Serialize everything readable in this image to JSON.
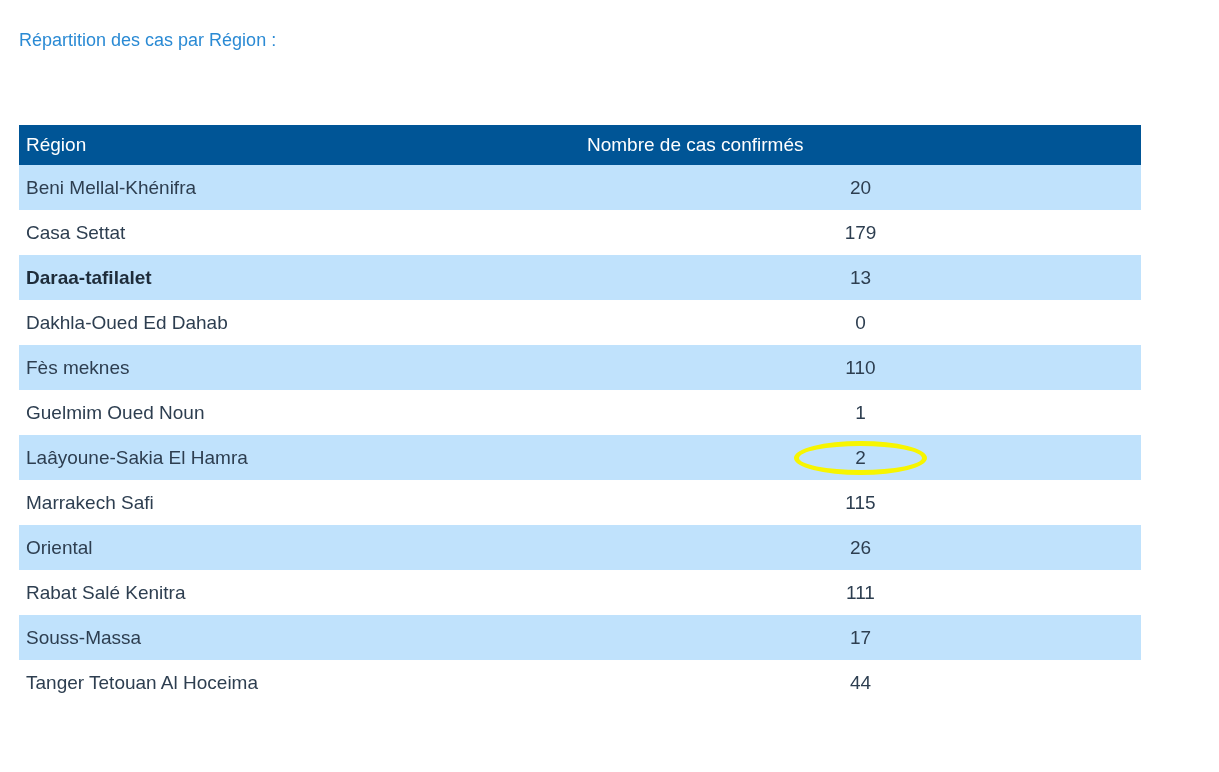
{
  "title": "Répartition des cas par Région :",
  "table": {
    "columns": [
      "Région",
      "Nombre de cas confirmés"
    ],
    "rows": [
      {
        "region": "Beni Mellal-Khénifra",
        "cases": "20",
        "bold": false,
        "circled": false
      },
      {
        "region": "Casa Settat",
        "cases": "179",
        "bold": false,
        "circled": false
      },
      {
        "region": "Daraa-tafilalet",
        "cases": "13",
        "bold": true,
        "circled": false
      },
      {
        "region": "Dakhla-Oued Ed Dahab",
        "cases": "0",
        "bold": false,
        "circled": false
      },
      {
        "region": "Fès meknes",
        "cases": "110",
        "bold": false,
        "circled": false
      },
      {
        "region": "Guelmim Oued Noun",
        "cases": "1",
        "bold": false,
        "circled": false
      },
      {
        "region": "Laâyoune-Sakia El Hamra",
        "cases": "2",
        "bold": false,
        "circled": true
      },
      {
        "region": "Marrakech Safi",
        "cases": "115",
        "bold": false,
        "circled": false
      },
      {
        "region": "Oriental",
        "cases": "26",
        "bold": false,
        "circled": false
      },
      {
        "region": "Rabat Salé Kenitra",
        "cases": "111",
        "bold": false,
        "circled": false
      },
      {
        "region": "Souss-Massa",
        "cases": "17",
        "bold": false,
        "circled": false
      },
      {
        "region": "Tanger Tetouan Al Hoceima",
        "cases": "44",
        "bold": false,
        "circled": false
      }
    ]
  }
}
